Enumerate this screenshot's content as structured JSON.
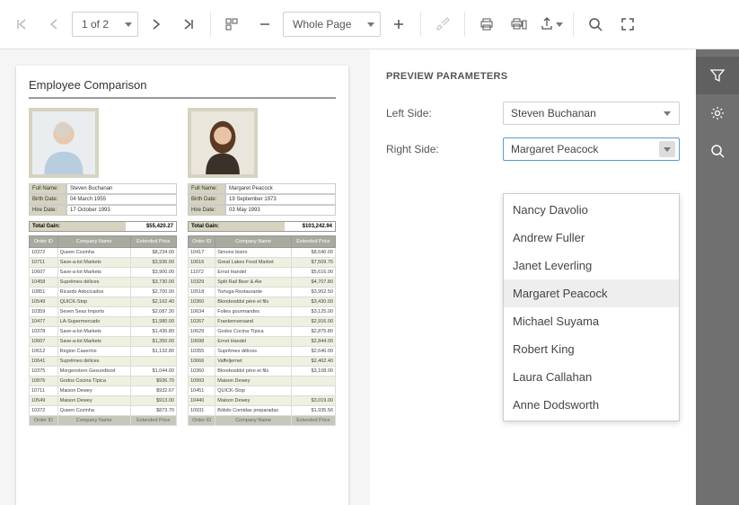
{
  "toolbar": {
    "pager_text": "1 of 2",
    "zoom_text": "Whole Page"
  },
  "sidebar": {
    "filter": "filter-icon",
    "settings": "gear-icon",
    "search": "search-icon"
  },
  "params": {
    "heading": "PREVIEW PARAMETERS",
    "left_label": "Left Side:",
    "right_label": "Right Side:",
    "left_value": "Steven Buchanan",
    "right_value": "Margaret Peacock",
    "options": [
      "Nancy Davolio",
      "Andrew Fuller",
      "Janet Leverling",
      "Margaret Peacock",
      "Michael Suyama",
      "Robert King",
      "Laura Callahan",
      "Anne Dodsworth"
    ]
  },
  "doc": {
    "title": "Employee Comparison",
    "labels": {
      "full_name": "Full Name:",
      "birth": "Birth Date:",
      "hire": "Hire Date:",
      "gain": "Total Gain:"
    },
    "headers": [
      "Order ID",
      "Company Name",
      "Extended Price"
    ],
    "left": {
      "name": "Steven Buchanan",
      "birth": "04 March 1955",
      "hire": "17 October 1993",
      "gain": "$55,420.27",
      "rows": [
        [
          "10372",
          "Queen Cozinha",
          "$8,234.00"
        ],
        [
          "10711",
          "Save-a-lot Markets",
          "$3,936.00"
        ],
        [
          "10607",
          "Save-a-lot Markets",
          "$3,900.00"
        ],
        [
          "10458",
          "Suprêmes délices",
          "$3,730.00"
        ],
        [
          "10851",
          "Ricardo Adocicados",
          "$2,700.00"
        ],
        [
          "10549",
          "QUICK-Stop",
          "$2,162.40"
        ],
        [
          "10359",
          "Seven Seas Imports",
          "$2,087.30"
        ],
        [
          "10477",
          "LA-Supermercado",
          "$1,980.00"
        ],
        [
          "10378",
          "Save-a-lot Markets",
          "$1,436.80"
        ],
        [
          "10607",
          "Save-a-lot Markets",
          "$1,350.00"
        ],
        [
          "10612",
          "Region Caseríos",
          "$1,132.80"
        ],
        [
          "10641",
          "Suprêmes délices",
          ""
        ],
        [
          "10375",
          "Morgenstern Gesundkost",
          "$1,044.00"
        ],
        [
          "10876",
          "Godos Cocina Típica",
          "$936.70"
        ],
        [
          "10711",
          "Maison Dewey",
          "$932.67"
        ],
        [
          "10549",
          "Maison Dewey",
          "$913.00"
        ],
        [
          "10372",
          "Queen Cozinha",
          "$873.70"
        ]
      ]
    },
    "right": {
      "name": "Margaret Peacock",
      "birth": "19 September 1973",
      "hire": "03 May 1993",
      "gain": "$103,242.94",
      "rows": [
        [
          "10417",
          "Simons bistro",
          "$8,640.00"
        ],
        [
          "10616",
          "Great Lakes Food Market",
          "$7,509.75"
        ],
        [
          "11072",
          "Ernst Handel",
          "$5,616.00"
        ],
        [
          "10329",
          "Split Rail Beer & Ale",
          "$4,707.80"
        ],
        [
          "10518",
          "Tortuga Restaurante",
          "$3,952.50"
        ],
        [
          "10360",
          "Blondesddsl père et fils",
          "$3,430.00"
        ],
        [
          "10634",
          "Folies gourmandes",
          "$3,125.00"
        ],
        [
          "10267",
          "Frankenversand",
          "$2,916.00"
        ],
        [
          "10629",
          "Godos Cocina Típica",
          "$2,875.80"
        ],
        [
          "10698",
          "Ernst Handel",
          "$2,844.00"
        ],
        [
          "10355",
          "Suprêmes délices",
          "$2,640.00"
        ],
        [
          "10666",
          "Vaffeljernet",
          "$2,462.40"
        ],
        [
          "10360",
          "Blondesddsl père et fils",
          "$3,108.00"
        ],
        [
          "10993",
          "Maison Dewey",
          ""
        ],
        [
          "10451",
          "QUICK-Stop",
          ""
        ],
        [
          "10440",
          "Maison Dewey",
          "$3,019.00"
        ],
        [
          "10931",
          "Bólido Comidas preparadas",
          "$1,935.56"
        ]
      ]
    }
  }
}
